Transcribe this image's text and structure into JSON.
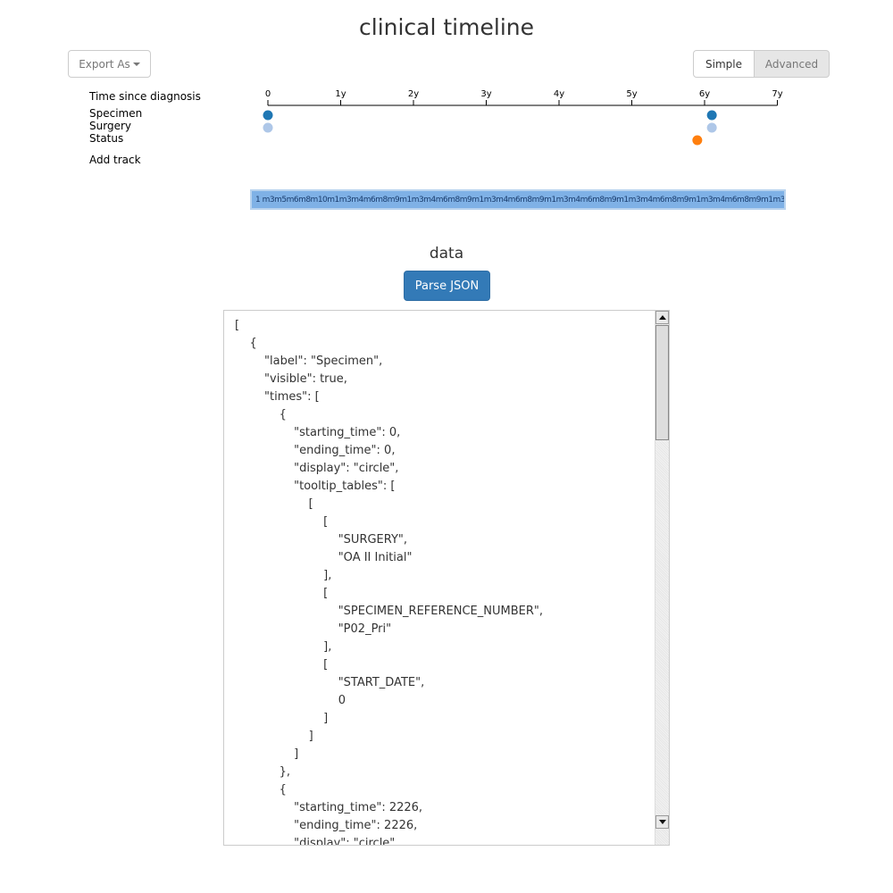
{
  "page_title": "clinical timeline",
  "toolbar": {
    "export_label": "Export As",
    "mode_options": [
      "Simple",
      "Advanced"
    ],
    "selected_mode": "Simple"
  },
  "timeline": {
    "axis_label": "Time since diagnosis",
    "axis_ticks": [
      "0",
      "1y",
      "2y",
      "3y",
      "4y",
      "5y",
      "6y",
      "7y"
    ],
    "tracks": [
      "Specimen",
      "Surgery",
      "Status"
    ],
    "add_track_label": "Add track",
    "events": [
      {
        "track": "Specimen",
        "time_years": 0,
        "color": "#1f77b4"
      },
      {
        "track": "Specimen",
        "time_years": 6.1,
        "color": "#1f77b4"
      },
      {
        "track": "Surgery",
        "time_years": 0,
        "color": "#aec7e8"
      },
      {
        "track": "Surgery",
        "time_years": 6.1,
        "color": "#aec7e8"
      },
      {
        "track": "Status",
        "time_years": 5.9,
        "color": "#ff7f0e"
      }
    ],
    "overview_labels": "1 m3m5m6m8m10m1m3m4m6m8m9m1m3m4m6m8m9m1m3m4m6m8m9m1m3m4m6m8m9m1m3m4m6m8m9m1m3m4m6m8m9m1m3m4m6m8m9m1m2m4m5m7m9m0m2m4m6m7m9m0m7m2m",
    "colors": {
      "specimen": "#1f77b4",
      "surgery": "#aec7e8",
      "status": "#ff7f0e",
      "overview": "#7fb1e6"
    }
  },
  "data_section": {
    "title": "data",
    "parse_button_label": "Parse JSON",
    "json_text": "[\n    {\n        \"label\": \"Specimen\",\n        \"visible\": true,\n        \"times\": [\n            {\n                \"starting_time\": 0,\n                \"ending_time\": 0,\n                \"display\": \"circle\",\n                \"tooltip_tables\": [\n                    [\n                        [\n                            \"SURGERY\",\n                            \"OA II Initial\"\n                        ],\n                        [\n                            \"SPECIMEN_REFERENCE_NUMBER\",\n                            \"P02_Pri\"\n                        ],\n                        [\n                            \"START_DATE\",\n                            0\n                        ]\n                    ]\n                ]\n            },\n            {\n                \"starting_time\": 2226,\n                \"ending_time\": 2226,\n                \"display\": \"circle\","
  }
}
